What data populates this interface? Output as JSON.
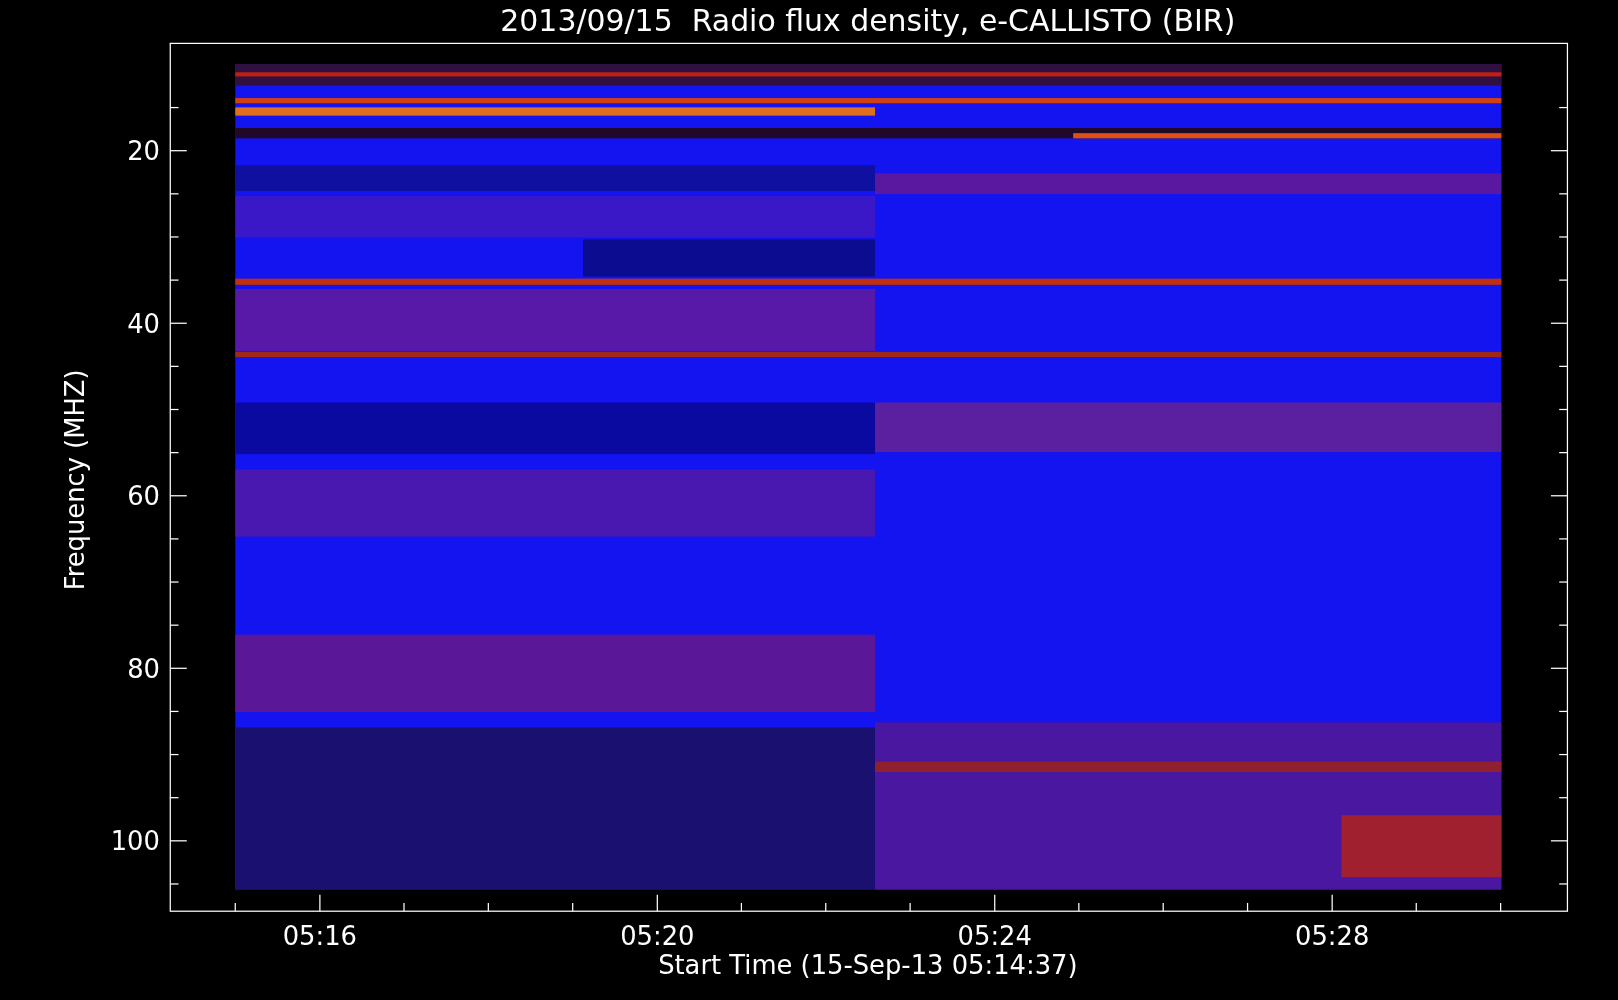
{
  "title": "2013/09/15  Radio flux density, e-CALLISTO (BIR)",
  "y_axis": {
    "label": "Frequency (MHZ)",
    "ticks": [
      "20",
      "40",
      "60",
      "80",
      "100"
    ]
  },
  "x_axis": {
    "label": "Start Time (15-Sep-13 05:14:37)",
    "ticks": [
      "05:16",
      "05:20",
      "05:24",
      "05:28"
    ]
  }
}
